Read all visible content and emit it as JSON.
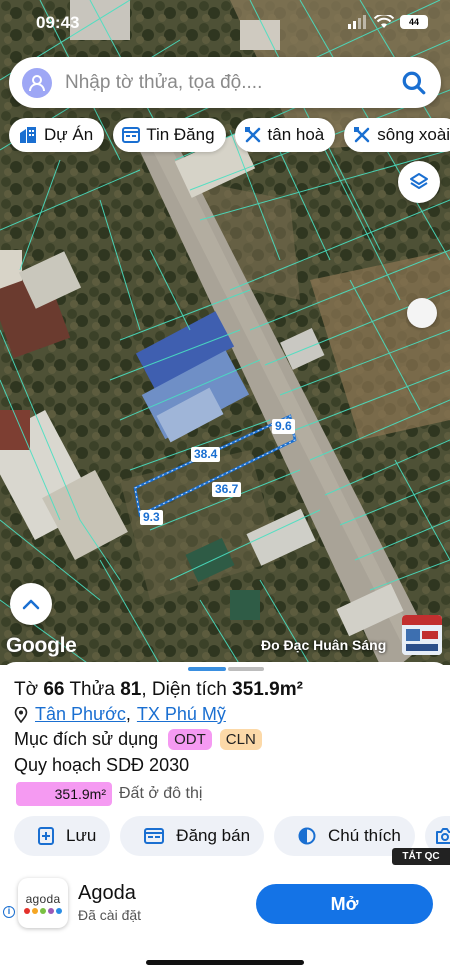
{
  "status_bar": {
    "time": "09:43",
    "battery": "44"
  },
  "search": {
    "placeholder": "Nhập tờ thửa, tọa độ...."
  },
  "chips": [
    {
      "label": "Dự Án",
      "icon": "building-icon"
    },
    {
      "label": "Tin Đăng",
      "icon": "listing-icon"
    },
    {
      "label": "tân hoà",
      "icon": "tool-icon"
    },
    {
      "label": "sông xoài",
      "icon": "tool-icon"
    }
  ],
  "map": {
    "attribution": "Google",
    "watermark": "Đo Đạc Huân Sáng",
    "dimensions": {
      "top": "38.4",
      "bottom": "36.7",
      "right": "9.6",
      "left": "9.3"
    }
  },
  "parcel": {
    "sheet_label": "Tờ",
    "sheet_no": "66",
    "plot_label": "Thửa",
    "plot_no": "81",
    "area_label": "Diện tích",
    "area": "351.9m²",
    "ward": "Tân Phước",
    "town": "TX Phú Mỹ",
    "purpose_label": "Mục đích sử dụng",
    "purpose_tags": [
      "ODT",
      "CLN"
    ],
    "plan_label": "Quy hoạch SDĐ 2030",
    "plan_area": "351.9m²",
    "plan_desc": "Đất ở đô thị"
  },
  "actions": [
    {
      "label": "Lưu",
      "icon": "save-icon"
    },
    {
      "label": "Đăng bán",
      "icon": "post-icon"
    },
    {
      "label": "Chú thích",
      "icon": "half-circle-icon"
    }
  ],
  "ad": {
    "hide_label": "TẮT QC",
    "app_name": "Agoda",
    "logo_text": "agoda",
    "status": "Đã cài đặt",
    "cta": "Mở",
    "info": "i"
  },
  "colors": {
    "accent": "#1473e6",
    "link": "#1a6fd1",
    "odt": "#f59af2",
    "cln": "#fcd9a8",
    "parcel_outline": "#1a6fd1",
    "cadastral_lines": "#49e0c2"
  }
}
